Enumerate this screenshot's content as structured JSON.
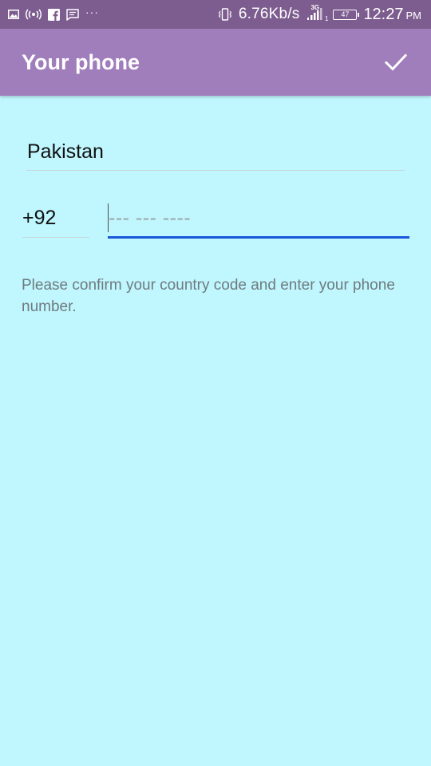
{
  "status_bar": {
    "network_speed": "6.76Kb/s",
    "signal_type": "3G",
    "sim_slot": "1",
    "battery_level": "47",
    "time": "12:27",
    "ampm": "PM",
    "more": "···"
  },
  "toolbar": {
    "title": "Your phone"
  },
  "form": {
    "country": "Pakistan",
    "country_code": "+92",
    "phone_value": "",
    "phone_placeholder": "--- --- ----"
  },
  "hint": {
    "text": "Please confirm your country code and enter your phone number."
  },
  "colors": {
    "status_bar": "#7d5c8f",
    "toolbar": "#a07dbb",
    "background": "#c0f6fe",
    "focus_underline": "#1a56d8"
  }
}
